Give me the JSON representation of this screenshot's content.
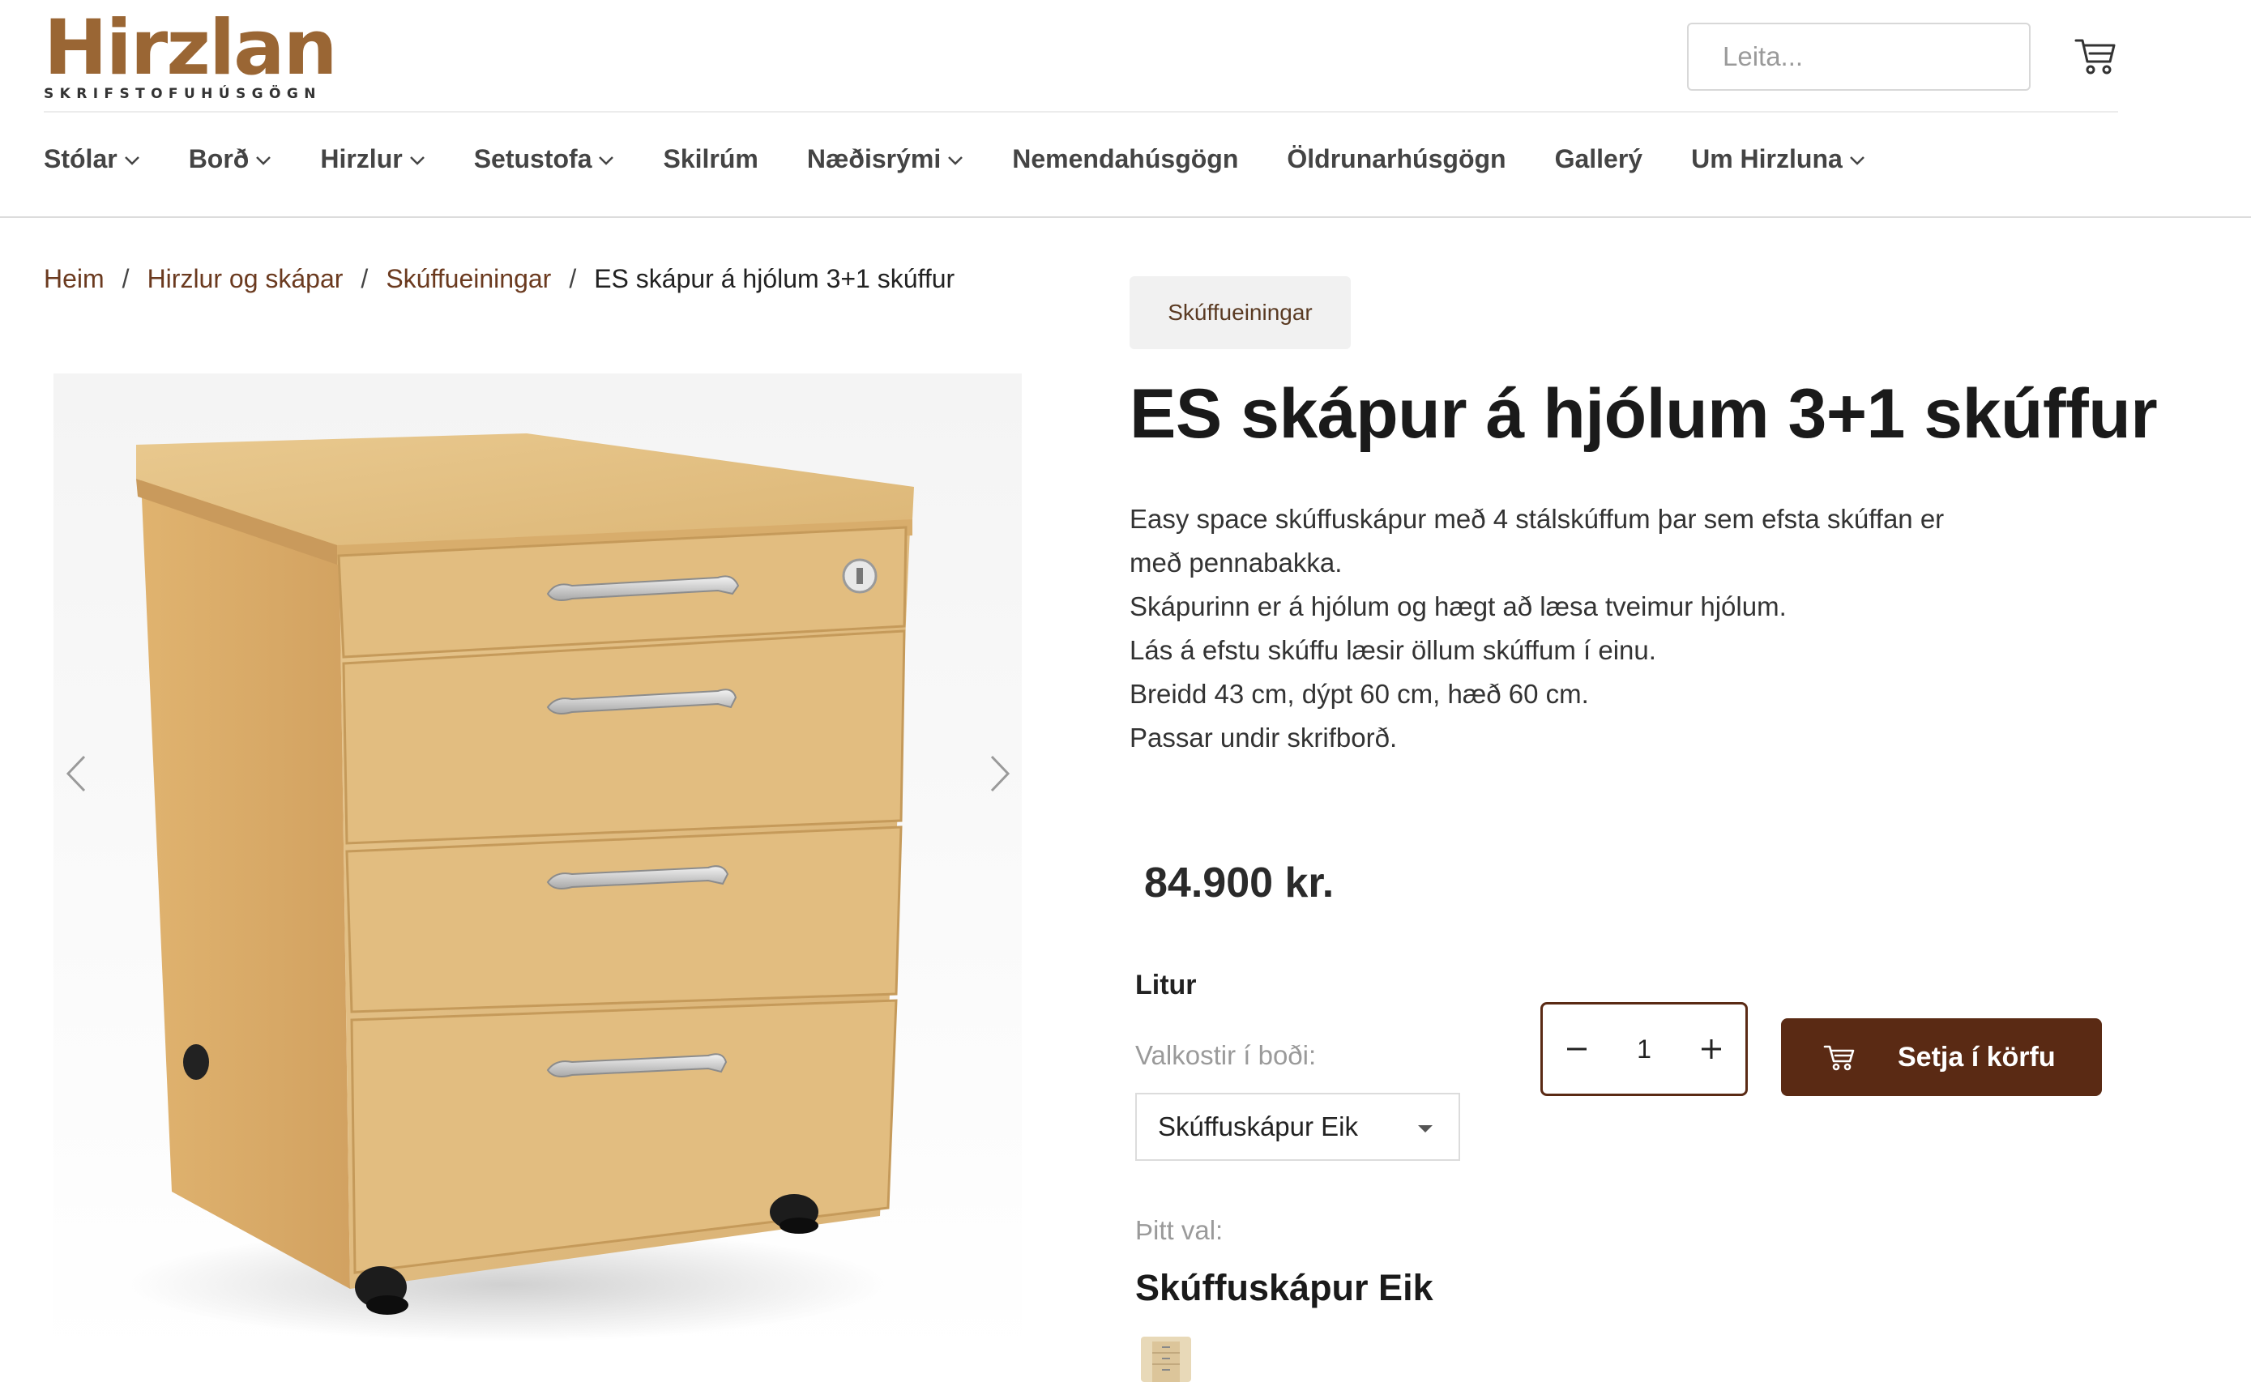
{
  "brand": {
    "name": "Hirzlan",
    "tagline": "SKRIFSTOFUHÚSGÖGN",
    "color": "#9a6634"
  },
  "search": {
    "placeholder": "Leita..."
  },
  "nav": {
    "items": [
      {
        "label": "Stólar",
        "has_dropdown": true
      },
      {
        "label": "Borð",
        "has_dropdown": true
      },
      {
        "label": "Hirzlur",
        "has_dropdown": true
      },
      {
        "label": "Setustofa",
        "has_dropdown": true
      },
      {
        "label": "Skilrúm",
        "has_dropdown": false
      },
      {
        "label": "Næðisrými",
        "has_dropdown": true
      },
      {
        "label": "Nemendahúsgögn",
        "has_dropdown": false
      },
      {
        "label": "Öldrunarhúsgögn",
        "has_dropdown": false
      },
      {
        "label": "Gallerý",
        "has_dropdown": false
      },
      {
        "label": "Um Hirzluna",
        "has_dropdown": true
      }
    ]
  },
  "breadcrumb": {
    "items": [
      "Heim",
      "Hirzlur og skápar",
      "Skúffueiningar"
    ],
    "separator": "/",
    "current": "ES skápur á hjólum 3+1 skúffur"
  },
  "product": {
    "category": "Skúffueiningar",
    "title": "ES skápur á hjólum 3+1 skúffur",
    "description": [
      "Easy space skúffuskápur með 4 stálskúffum þar sem efsta skúffan er",
      "með pennabakka.",
      "Skápurinn er á hjólum og hægt að læsa tveimur hjólum.",
      "Lás á efstu skúffu læsir öllum skúffum í einu.",
      "Breidd 43 cm, dýpt 60 cm, hæð 60 cm.",
      "Passar undir skrifborð."
    ],
    "price": "84.900 kr.",
    "option_label": "Litur",
    "option_sub": "Valkostir í boði:",
    "selected_option": "Skúffuskápur Eik",
    "quantity": "1",
    "add_to_cart": "Setja í körfu",
    "selection_label": "Þitt val:",
    "selection_value": "Skúffuskápur Eik"
  },
  "colors": {
    "accent": "#5a2a14",
    "link": "#6b3a1f",
    "wood": "#e0b97a"
  },
  "icons": {
    "cart": "cart-icon",
    "chevron": "chevron-down-icon",
    "prev": "chevron-left-icon",
    "next": "chevron-right-icon",
    "minus": "minus-icon",
    "plus": "plus-icon",
    "select_caret": "caret-down-icon"
  }
}
